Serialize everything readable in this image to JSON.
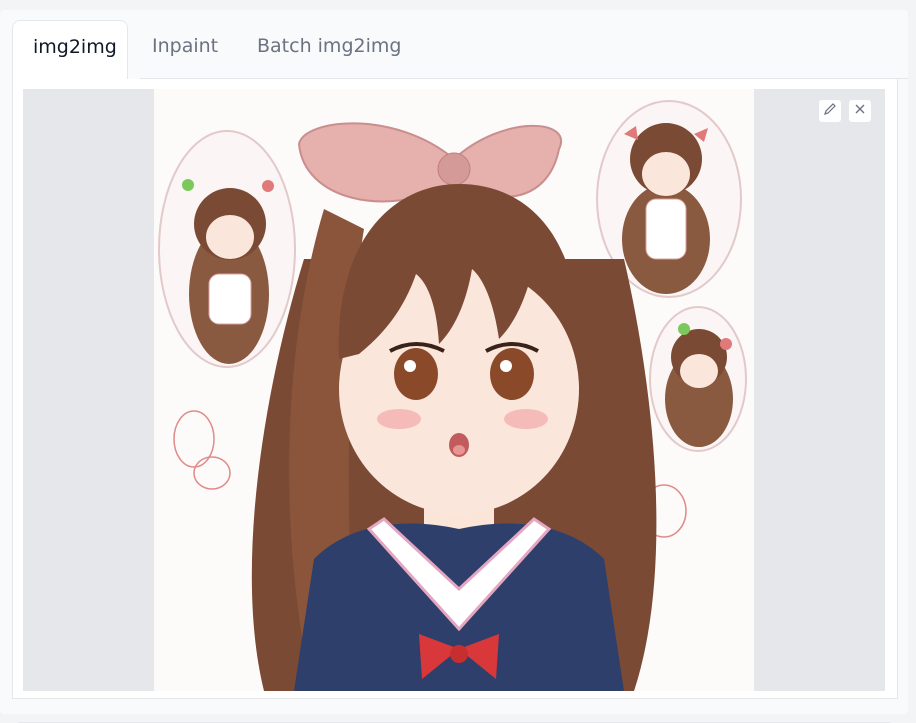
{
  "tabs": [
    {
      "label": "img2img",
      "active": true
    },
    {
      "label": "Inpaint",
      "active": false
    },
    {
      "label": "Batch img2img",
      "active": false
    }
  ],
  "image_tools": {
    "edit_icon": "pencil-icon",
    "close_icon": "close-icon"
  },
  "colors": {
    "hair": "#7a4a34",
    "bow": "#e8b4b4",
    "uniform": "#2e3f6b",
    "ribbon": "#d9383a",
    "canvas_bg": "#e5e7eb"
  }
}
